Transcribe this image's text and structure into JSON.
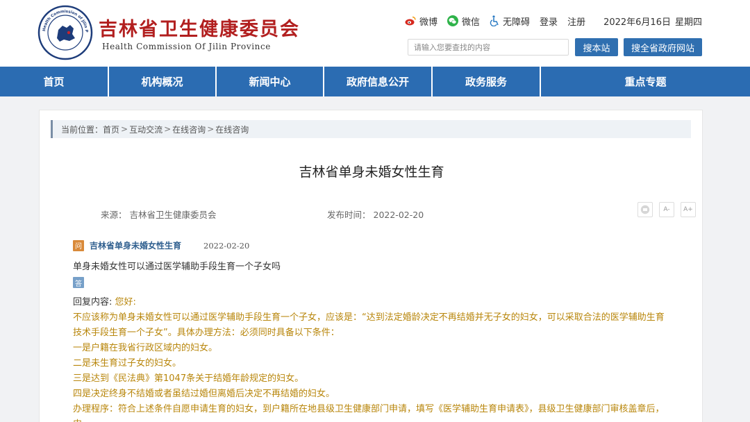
{
  "header": {
    "title": "吉林省卫生健康委员会",
    "subtitle": "Health Commission Of Jilin Province",
    "seal_text": "Health Commission of Jilin Province",
    "links": [
      {
        "label": "微博",
        "icon": "weibo-icon"
      },
      {
        "label": "微信",
        "icon": "wechat-icon"
      },
      {
        "label": "无障碍",
        "icon": "accessibility-icon"
      },
      {
        "label": "登录"
      },
      {
        "label": "注册"
      }
    ],
    "date": "2022年6月16日",
    "weekday": "星期四",
    "search_placeholder": "请输入您要查找的内容",
    "search_site_label": "搜本站",
    "search_province_label": "搜全省政府网站"
  },
  "nav": [
    {
      "label": "首页"
    },
    {
      "label": "机构概况"
    },
    {
      "label": "新闻中心"
    },
    {
      "label": "政府信息公开"
    },
    {
      "label": "政务服务"
    },
    {
      "label": "重点专题"
    }
  ],
  "breadcrumb": {
    "prefix": "当前位置：",
    "items": [
      "首页",
      "互动交流",
      "在线咨询",
      "在线咨询"
    ],
    "separator": ">"
  },
  "article": {
    "title": "吉林省单身未婚女性生育",
    "source_label": "来源：",
    "source": "吉林省卫生健康委员会",
    "publish_label": "发布时间：",
    "publish_date": "2022-02-20",
    "tools": [
      "A-",
      "A+"
    ]
  },
  "question": {
    "badge": "问",
    "title": "吉林省单身未婚女性生育",
    "date": "2022-02-20",
    "text": "单身未婚女性可以通过医学辅助手段生育一个子女吗"
  },
  "answer": {
    "badge": "答",
    "reply_label": "回复内容:",
    "greeting": "您好:",
    "paragraphs": [
      "不应该称为单身未婚女性可以通过医学辅助手段生育一个子女，应该是：“达到法定婚龄决定不再结婚并无子女的妇女，可以采取合法的医学辅助生育技术手段生育一个子女”。具体办理方法：必须同时具备以下条件：",
      "一是户籍在我省行政区域内的妇女。",
      "二是未生育过子女的妇女。",
      "三是达到《民法典》第1047条关于结婚年龄规定的妇女。",
      "四是决定终身不结婚或者虽结过婚但离婚后决定不再结婚的妇女。",
      "办理程序：符合上述条件自愿申请生育的妇女，到户籍所在地县级卫生健康部门申请，填写《医学辅助生育申请表》，县级卫生健康部门审核盖章后，申"
    ]
  },
  "colors": {
    "brand_red": "#b21f1f",
    "nav_blue": "#2b6cb2",
    "button_blue": "#2f6fb0",
    "reply_text": "#b8860b"
  }
}
